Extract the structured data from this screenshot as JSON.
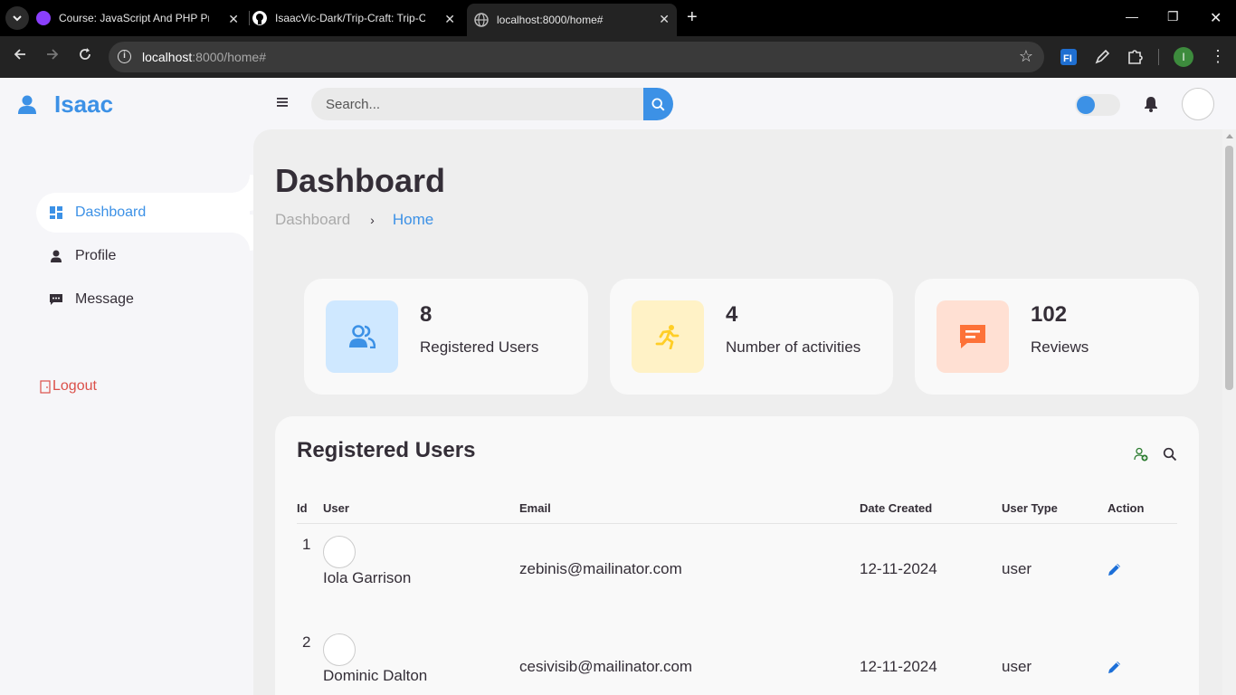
{
  "browser": {
    "tabs": [
      {
        "title": "Course: JavaScript And PHP Pro",
        "favicon_color": "#8a3ffc"
      },
      {
        "title": "IsaacVic-Dark/Trip-Craft: Trip-Cr",
        "favicon_color": "#ffffff"
      },
      {
        "title": "localhost:8000/home#",
        "favicon_color": "#9e9e9e"
      }
    ],
    "url_host": "localhost",
    "url_path": ":8000/home#",
    "profile_initial": "I"
  },
  "sidebar": {
    "brand": "Isaac",
    "items": [
      {
        "label": "Dashboard"
      },
      {
        "label": "Profile"
      },
      {
        "label": "Message"
      }
    ],
    "logout": "Logout"
  },
  "topnav": {
    "search_placeholder": "Search..."
  },
  "page": {
    "title": "Dashboard",
    "breadcrumb": [
      "Dashboard",
      "Home"
    ]
  },
  "stats": [
    {
      "value": "8",
      "label": "Registered Users",
      "color": "#3c91e6",
      "bg": "#cfe8ff",
      "icon": "users-icon"
    },
    {
      "value": "4",
      "label": "Number of activities",
      "color": "#ffce26",
      "bg": "#fff2c6",
      "icon": "running-icon"
    },
    {
      "value": "102",
      "label": "Reviews",
      "color": "#fd7238",
      "bg": "#ffe0d3",
      "icon": "comment-icon"
    }
  ],
  "users_table": {
    "title": "Registered Users",
    "columns": [
      "Id",
      "User",
      "Email",
      "Date Created",
      "User Type",
      "Action"
    ],
    "rows": [
      {
        "id": "1",
        "name": "Iola Garrison",
        "email": "zebinis@mailinator.com",
        "date": "12-11-2024",
        "type": "user"
      },
      {
        "id": "2",
        "name": "Dominic Dalton",
        "email": "cesivisib@mailinator.com",
        "date": "12-11-2024",
        "type": "user"
      }
    ]
  },
  "colors": {
    "accent": "#3c91e6",
    "danger": "#db504a",
    "text": "#342e37"
  }
}
